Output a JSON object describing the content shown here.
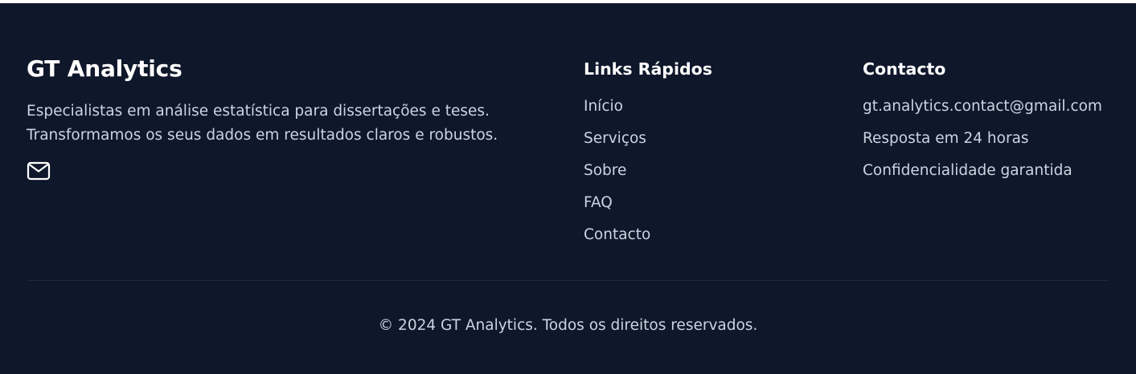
{
  "brand": {
    "title": "GT Analytics",
    "description": "Especialistas em análise estatística para dissertações e teses.\nTransformamos os seus dados em resultados claros e robustos.",
    "mail_icon": "mail-icon"
  },
  "quick_links": {
    "heading": "Links Rápidos",
    "items": [
      {
        "label": "Início"
      },
      {
        "label": "Serviços"
      },
      {
        "label": "Sobre"
      },
      {
        "label": "FAQ"
      },
      {
        "label": "Contacto"
      }
    ]
  },
  "contact": {
    "heading": "Contacto",
    "email": "gt.analytics.contact@gmail.com",
    "response_time": "Resposta em 24 horas",
    "confidentiality": "Confidencialidade garantida"
  },
  "copyright": "© 2024 GT Analytics. Todos os direitos reservados.",
  "colors": {
    "background": "#0f172a",
    "text_primary": "#ffffff",
    "text_secondary": "#cbd5e1",
    "divider": "#1e293b"
  }
}
